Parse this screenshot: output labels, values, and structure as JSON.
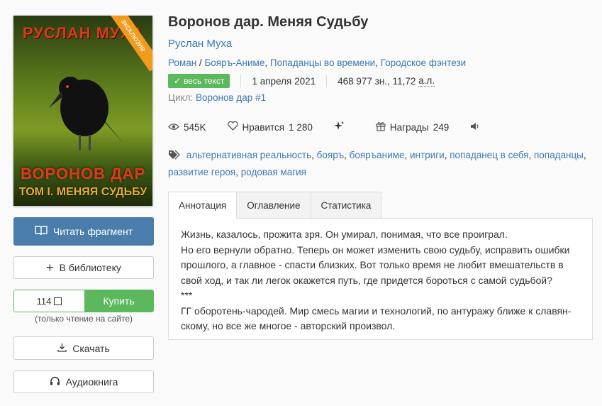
{
  "cover": {
    "author_text": "РУСЛАН МУХА",
    "title_line1": "ВОРОНОВ ДАР",
    "title_line2": "ТОМ I. МЕНЯЯ СУДЬБУ",
    "ribbon": "эксклюзив"
  },
  "actions": {
    "read_fragment": "Читать фрагмент",
    "add_library": "В библиотеку",
    "price": "114",
    "currency_icon": "ruble-box-icon",
    "buy": "Купить",
    "note": "(только чтение на сайте)",
    "download": "Скачать",
    "audiobook": "Аудиокнига"
  },
  "book": {
    "title": "Воронов дар. Меняя Судьбу",
    "author": "Руслан Муха",
    "genres": [
      "Роман",
      "Бояръ-Аниме",
      "Попаданцы во времени",
      "Городское фэнтези"
    ],
    "status_badge": "весь текст",
    "date": "1 апреля 2021",
    "size": "468 977 зн., 11,72",
    "size_unit": "а.л.",
    "cycle_label": "Цикл:",
    "cycle_name": "Воронов дар",
    "cycle_number": "#1"
  },
  "stats": {
    "views": "545K",
    "likes_label": "Нравится",
    "likes_count": "1 280",
    "awards_label": "Награды",
    "awards_count": "249"
  },
  "tags": [
    "альтернативная реальность",
    "бояръ",
    "бояръаниме",
    "интриги",
    "попаданец в себя",
    "попаданцы",
    "развитие героя",
    "родовая магия"
  ],
  "tabs": [
    "Аннотация",
    "Оглавление",
    "Статистика"
  ],
  "annotation": [
    "Жизнь, казалось, прожита зря. Он умирал, понимая, что все проиграл.",
    "Но его вернули обратно. Теперь он может изменить свою судьбу, исправить ошибки прошлого, а главное - спасти близких. Вот только время не любит вмешательств в свой ход, и так ли легок окажется путь, где придется бороться с самой судьбой?",
    "***",
    "ГГ оборотень-чародей. Мир смесь магии и технологий, по антуражу ближе к славян­скому, но все же многое - авторский произвол."
  ]
}
